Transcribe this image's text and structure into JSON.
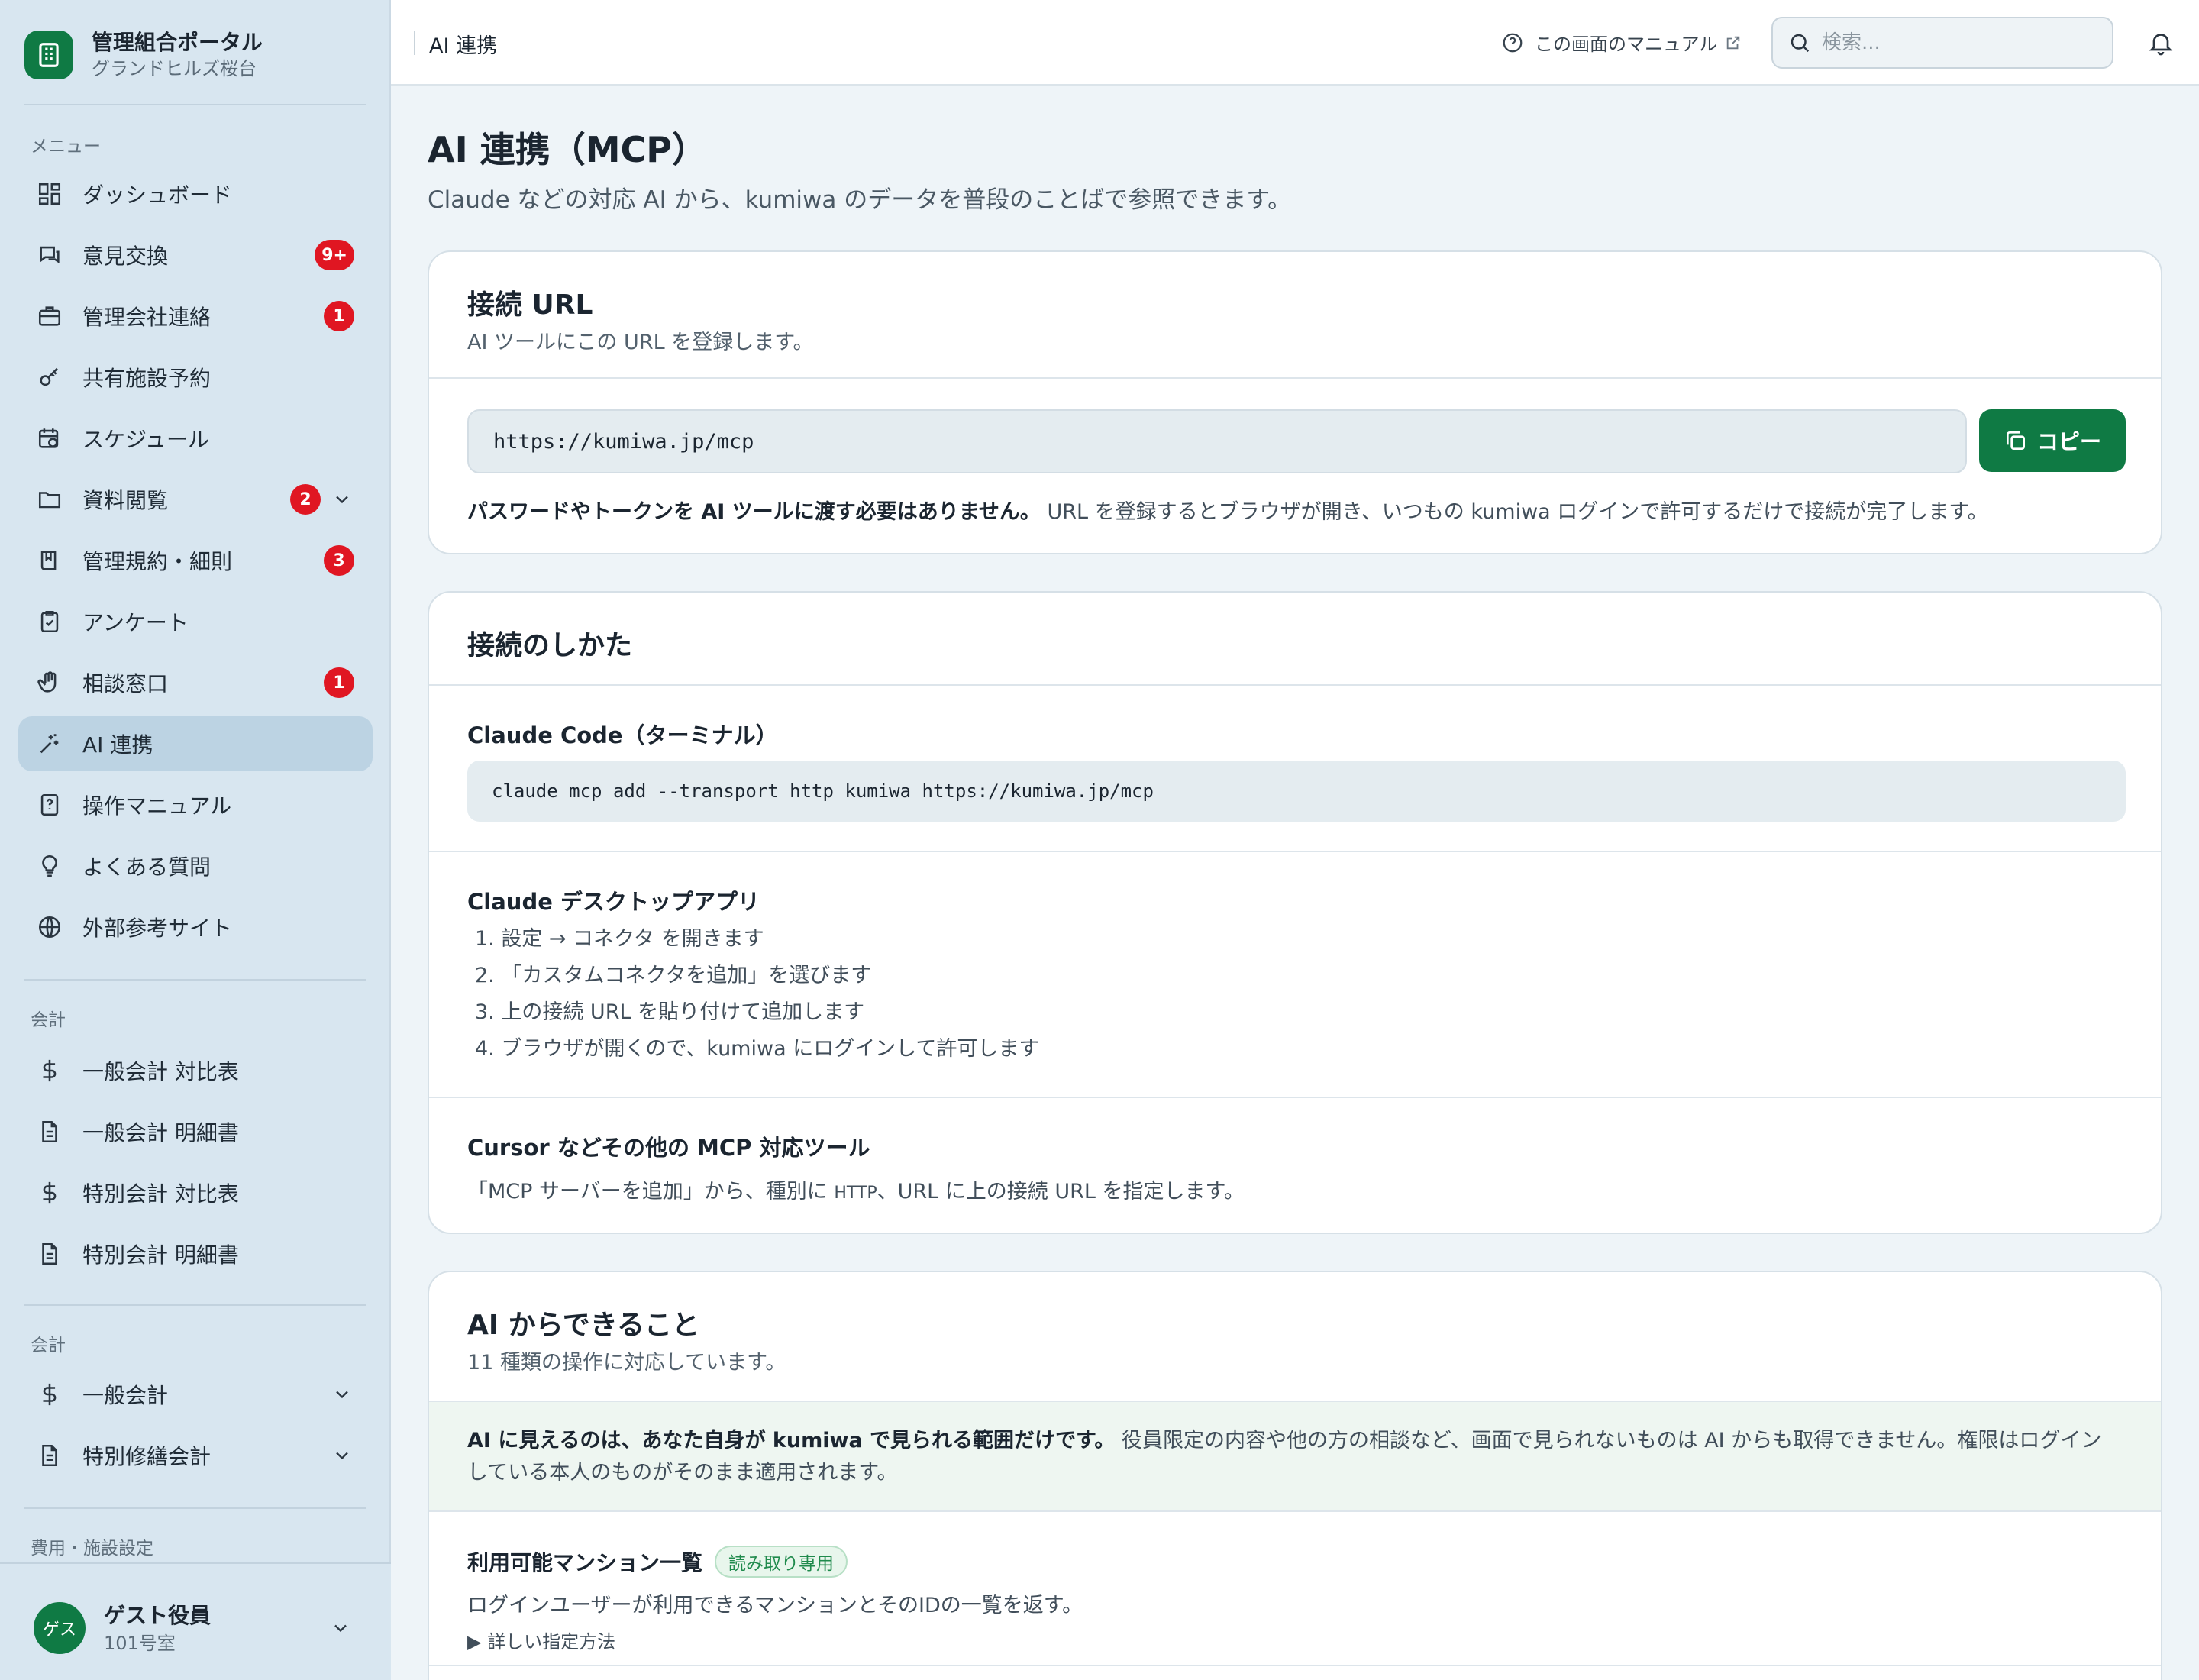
{
  "brand": {
    "title": "管理組合ポータル",
    "subtitle": "グランドヒルズ桜台"
  },
  "sidebar": {
    "menu_label": "メニュー",
    "items": [
      {
        "label": "ダッシュボード",
        "icon": "dashboard-icon"
      },
      {
        "label": "意見交換",
        "icon": "chat-icon",
        "badge": "9+"
      },
      {
        "label": "管理会社連絡",
        "icon": "briefcase-icon",
        "badge": "1"
      },
      {
        "label": "共有施設予約",
        "icon": "key-icon"
      },
      {
        "label": "スケジュール",
        "icon": "calendar-clock-icon"
      },
      {
        "label": "資料閲覧",
        "icon": "folder-icon",
        "badge": "2"
      },
      {
        "label": "管理規約・細則",
        "icon": "book-icon",
        "badge": "3"
      },
      {
        "label": "アンケート",
        "icon": "clipboard-check-icon"
      },
      {
        "label": "相談窓口",
        "icon": "hand-icon",
        "badge": "1"
      },
      {
        "label": "AI 連携",
        "icon": "sparkles-icon",
        "active": true
      },
      {
        "label": "操作マニュアル",
        "icon": "help-book-icon"
      },
      {
        "label": "よくある質問",
        "icon": "lightbulb-icon"
      },
      {
        "label": "外部参考サイト",
        "icon": "globe-icon"
      }
    ],
    "accounting_label": "会計",
    "accounting_items": [
      {
        "label": "一般会計 対比表",
        "icon": "dollar-icon"
      },
      {
        "label": "一般会計 明細書",
        "icon": "document-icon"
      },
      {
        "label": "特別会計 対比表",
        "icon": "dollar-icon"
      },
      {
        "label": "特別会計 明細書",
        "icon": "document-icon"
      }
    ],
    "accounting2_label": "会計",
    "accounting2_items": [
      {
        "label": "一般会計",
        "icon": "dollar-icon"
      },
      {
        "label": "特別修繕会計",
        "icon": "document-icon"
      }
    ],
    "settings_label": "費用・施設設定",
    "user": {
      "avatar_text": "ゲス",
      "name": "ゲスト役員",
      "room": "101号室"
    }
  },
  "topbar": {
    "title": "AI 連携",
    "manual_link": "この画面のマニュアル",
    "search_placeholder": "検索..."
  },
  "page": {
    "title": "AI 連携（MCP）",
    "subtitle": "Claude などの対応 AI から、kumiwa のデータを普段のことばで参照できます。"
  },
  "url_card": {
    "title": "接続 URL",
    "desc": "AI ツールにこの URL を登録します。",
    "url": "https://kumiwa.jp/mcp",
    "copy_label": "コピー",
    "note_bold": "パスワードやトークンを AI ツールに渡す必要はありません。",
    "note_rest": " URL を登録するとブラウザが開き、いつもの kumiwa ログインで許可するだけで接続が完了します。"
  },
  "howto_card": {
    "title": "接続のしかた",
    "claude_code_title": "Claude Code（ターミナル）",
    "claude_code_cmd": "claude mcp add --transport http kumiwa https://kumiwa.jp/mcp",
    "desktop_title": "Claude デスクトップアプリ",
    "desktop_steps": [
      "1. 設定 → コネクタ を開きます",
      "2. 「カスタムコネクタを追加」を選びます",
      "3. 上の接続 URL を貼り付けて追加します",
      "4. ブラウザが開くので、kumiwa にログインして許可します"
    ],
    "cursor_title": "Cursor などその他の MCP 対応ツール",
    "cursor_text_a": "「MCP サーバーを追加」から、種別に ",
    "cursor_text_http": "HTTP",
    "cursor_text_b": "、URL に上の接続 URL を指定します。"
  },
  "ai_card": {
    "title": "AI からできること",
    "desc": "11 種類の操作に対応しています。",
    "notice_bold": "AI に見えるのは、あなた自身が kumiwa で見られる範囲だけです。",
    "notice_rest": " 役員限定の内容や他の方の相談など、画面で見られないものは AI からも取得できません。権限はログインしている本人のものがそのまま適用されます。",
    "tool_name": "利用可能マンション一覧",
    "tool_badge": "読み取り専用",
    "tool_desc": "ログインユーザーが利用できるマンションとそのIDの一覧を返す。",
    "details_label": "▶ 詳しい指定方法"
  },
  "colors": {
    "accent": "#0f7a44",
    "badge": "#e01622",
    "sidebar_bg": "#d8e6f0",
    "active_item": "#bcd3e3"
  }
}
